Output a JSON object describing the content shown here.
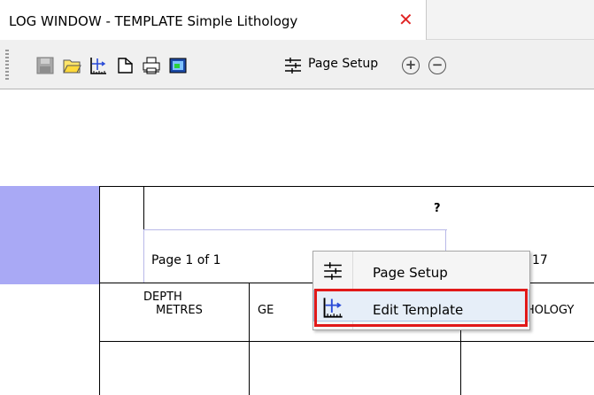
{
  "tab": {
    "title": "LOG WINDOW - TEMPLATE Simple Lithology",
    "close_glyph": "✕"
  },
  "toolbar": {
    "icons": [
      "save-icon",
      "open-folder-icon",
      "edit-template-icon",
      "page-icon",
      "print-icon",
      "image-icon",
      "page-setup-icon",
      "zoom-in-icon",
      "zoom-out-icon"
    ],
    "page_setup_label": "Page Setup",
    "zoom_in_glyph": "+",
    "zoom_out_glyph": "−"
  },
  "log": {
    "header_placeholder": "?",
    "page_info": "Page 1 of 1",
    "right_value": "17",
    "columns": {
      "depth_title": "DEPTH",
      "depth_unit": "METRES",
      "col2_partial": "GE",
      "col3_partial": "HOLOGY"
    }
  },
  "context_menu": {
    "items": [
      {
        "label": "Page Setup",
        "icon": "page-setup-icon"
      },
      {
        "label": "Edit Template",
        "icon": "edit-template-icon",
        "highlighted": true
      }
    ]
  },
  "colors": {
    "accent_red": "#e11919",
    "band_blue": "#a9a9f5",
    "close_red": "#e02424"
  }
}
